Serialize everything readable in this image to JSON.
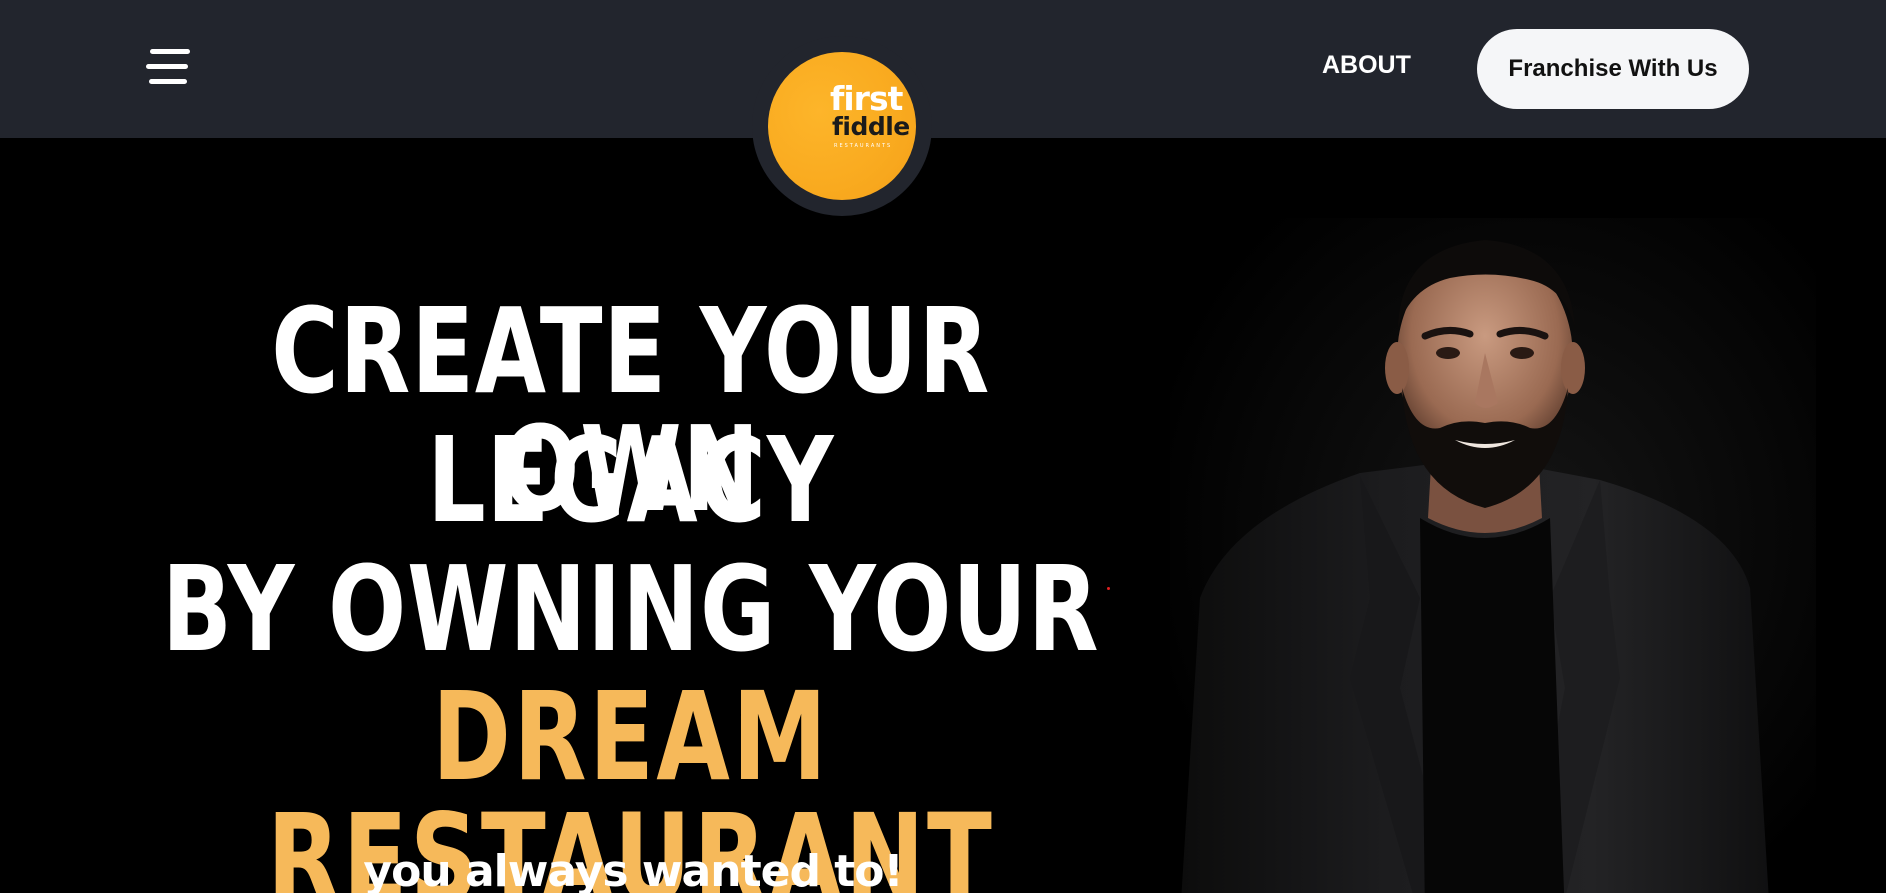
{
  "header": {
    "menu_icon": "hamburger-menu-icon",
    "logo": {
      "text_top": "first",
      "text_bottom": "fiddle",
      "tagline": "RESTAURANTS"
    },
    "nav": {
      "about_label": "ABOUT",
      "franchise_label": "Franchise With Us"
    }
  },
  "hero": {
    "headline": {
      "line1": "CREATE YOUR OWN",
      "line2": "LEGACY",
      "line3": "BY OWNING YOUR",
      "line4": "DREAM RESTAURANT"
    },
    "subline": "you always wanted to!",
    "portrait_image": "man-in-black-blazer-photo"
  },
  "colors": {
    "header_bg": "#22252d",
    "hero_bg": "#000000",
    "accent_gold": "#f6b95a",
    "logo_orange": "#f9aa1f",
    "button_bg": "#f5f6f8"
  }
}
